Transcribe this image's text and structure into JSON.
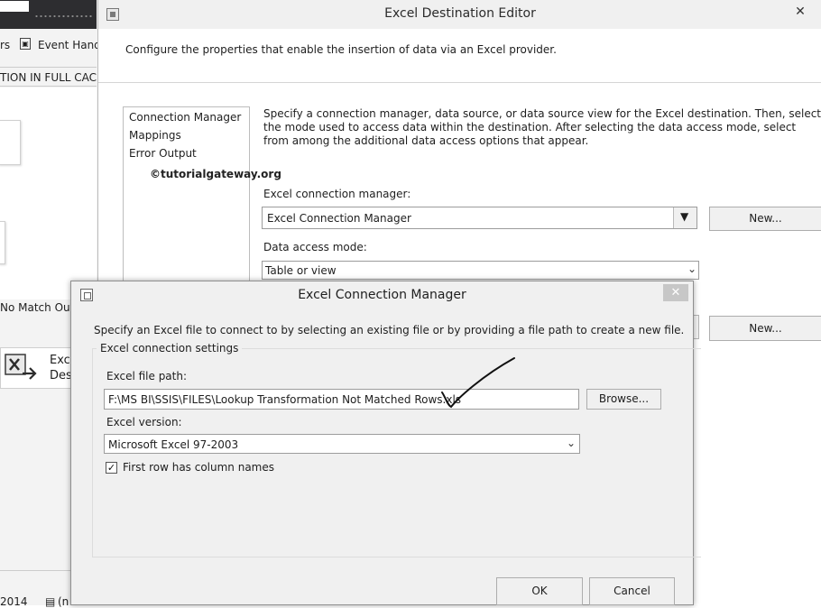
{
  "background": {
    "tabs": [
      "rs",
      "Event Hand"
    ],
    "status_text": "TION IN FULL CACHE",
    "no_match_label": "No Match Outp",
    "excel_component_label": "Exce\nDest",
    "bottom_left": "2014",
    "bottom_right": "(n"
  },
  "editor": {
    "title": "Excel Destination Editor",
    "header_description": "Configure the properties that enable the insertion of data via an Excel provider.",
    "nav_items": [
      "Connection Manager",
      "Mappings",
      "Error Output"
    ],
    "watermark": "©tutorialgateway.org",
    "instructions": "Specify a connection manager, data source, or data source view for the Excel destination. Then, select the mode used to access data within the destination. After selecting the data access mode, select from among the additional data access options that appear.",
    "connection_manager_label": "Excel connection manager:",
    "connection_manager_value": "Excel Connection Manager",
    "new_button": "New...",
    "data_access_label": "Data access mode:",
    "data_access_value": "Table or view",
    "new_button_2": "New..."
  },
  "dialog": {
    "title": "Excel Connection Manager",
    "description": "Specify an Excel file to connect to by selecting an existing file or by providing a file path to create a new file.",
    "group_title": "Excel connection settings",
    "file_path_label": "Excel file path:",
    "file_path_value": "F:\\MS BI\\SSIS\\FILES\\Lookup Transformation Not Matched Rows.xls",
    "browse_button": "Browse...",
    "version_label": "Excel version:",
    "version_value": "Microsoft Excel 97-2003",
    "first_row_label": "First row has column names",
    "first_row_checked": true,
    "ok_button": "OK",
    "cancel_button": "Cancel"
  }
}
